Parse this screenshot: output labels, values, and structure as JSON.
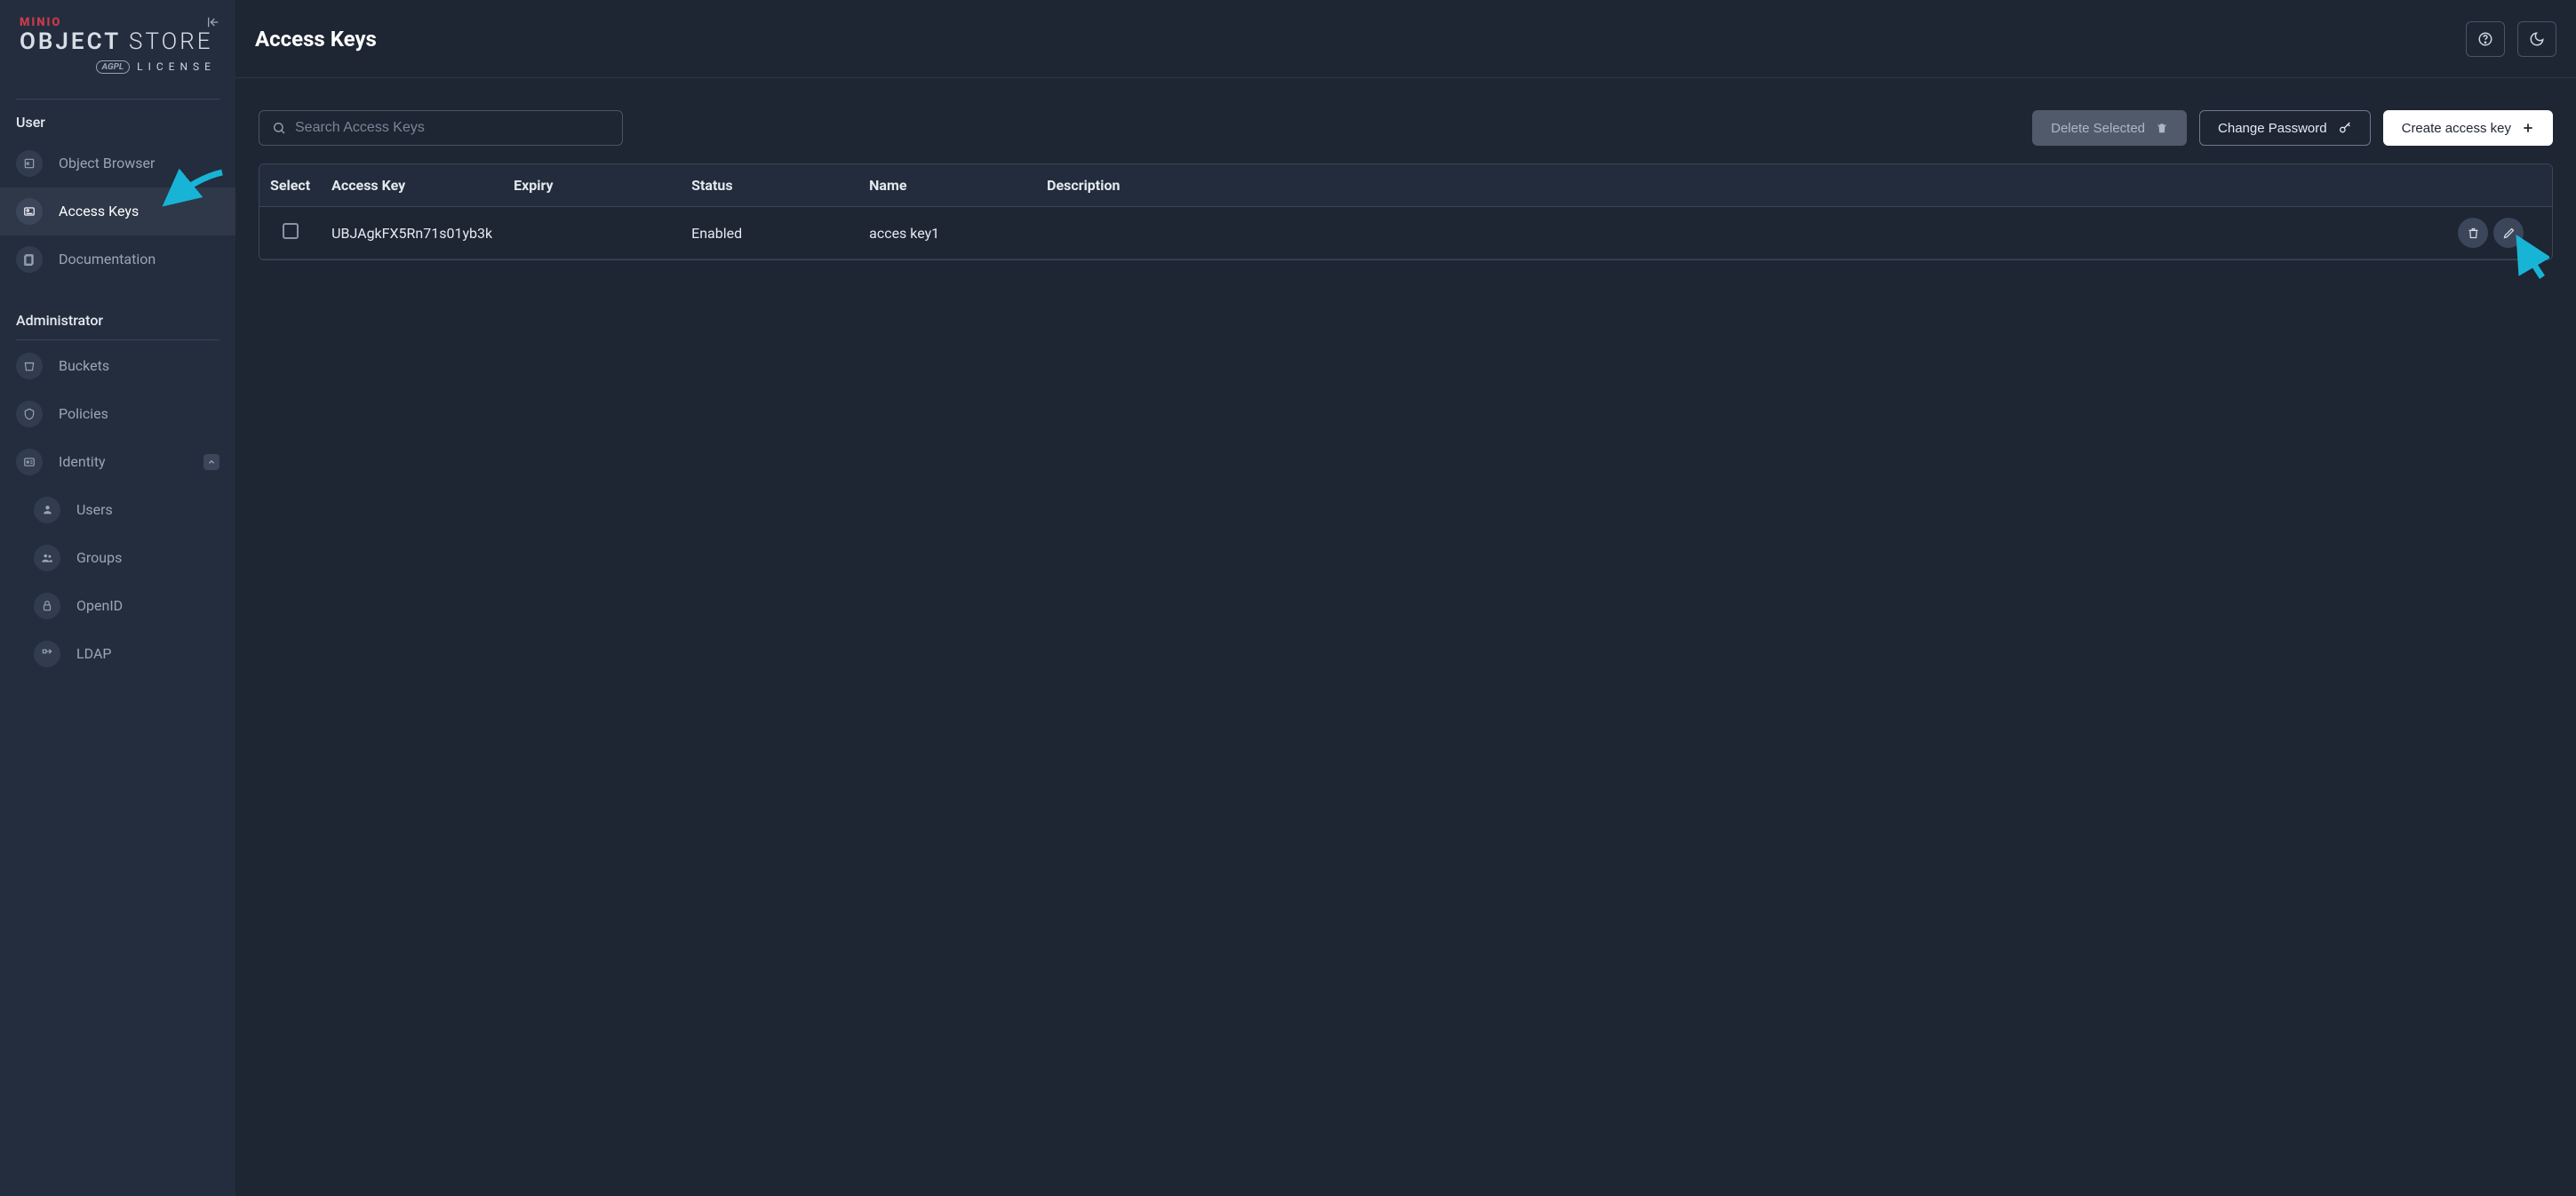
{
  "brand": {
    "minio": "MINIO",
    "object": "OBJECT",
    "store": "STORE",
    "agpl": "AGPL",
    "license": "LICENSE"
  },
  "sidebar": {
    "sections": {
      "user_title": "User",
      "admin_title": "Administrator"
    },
    "items": {
      "object_browser": "Object Browser",
      "access_keys": "Access Keys",
      "documentation": "Documentation",
      "buckets": "Buckets",
      "policies": "Policies",
      "identity": "Identity",
      "users": "Users",
      "groups": "Groups",
      "openid": "OpenID",
      "ldap": "LDAP"
    }
  },
  "page": {
    "title": "Access Keys"
  },
  "toolbar": {
    "search_placeholder": "Search Access Keys",
    "delete_selected": "Delete Selected",
    "change_password": "Change Password",
    "create_access_key": "Create access key"
  },
  "table": {
    "headers": {
      "select": "Select",
      "access_key": "Access Key",
      "expiry": "Expiry",
      "status": "Status",
      "name": "Name",
      "description": "Description"
    },
    "rows": [
      {
        "access_key": "UBJAgkFX5Rn71s01yb3k",
        "expiry": "",
        "status": "Enabled",
        "name": "acces key1",
        "description": ""
      }
    ]
  }
}
